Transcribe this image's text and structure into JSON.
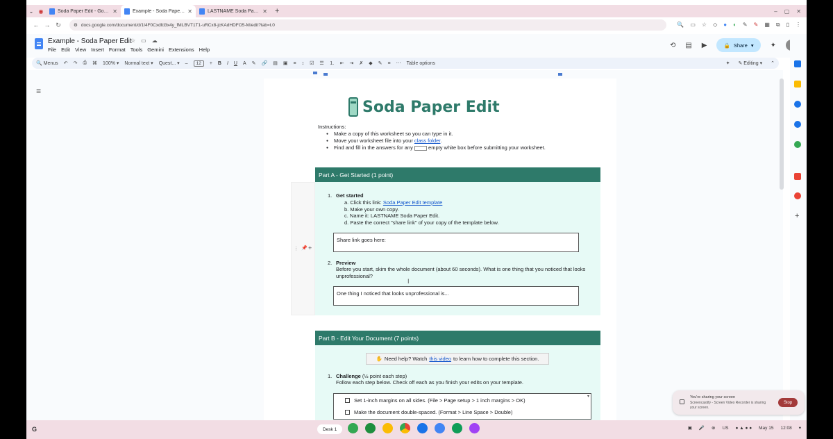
{
  "browser": {
    "tabs": [
      {
        "label": "Soda Paper Edit - Google Docs"
      },
      {
        "label": "Example - Soda Paper Edit - Go"
      },
      {
        "label": "LASTNAME Soda Paper Edit - G"
      }
    ],
    "url": "docs.google.com/document/d/1I4F0Cxdfd3x4y_fMLBVT1T1-uRCx8-jcKAdHDFO5-M/edit?tab=t.0"
  },
  "docs": {
    "title": "Example - Soda Paper Edit",
    "menu": [
      "File",
      "Edit",
      "View",
      "Insert",
      "Format",
      "Tools",
      "Gemini",
      "Extensions",
      "Help"
    ],
    "share_label": "Share",
    "toolbar": {
      "menus": "Menus",
      "zoom": "100%",
      "style": "Normal text",
      "font": "Quest...",
      "size": "12",
      "table_options": "Table options",
      "mode": "Editing"
    }
  },
  "content": {
    "title": "Soda Paper Edit",
    "instructions_label": "Instructions:",
    "instructions": [
      {
        "text": "Make a copy of this worksheet so you can type in it."
      },
      {
        "pre": "Move your worksheet file into your ",
        "link": "class folder",
        "post": "."
      },
      {
        "pre": "Find and fill in the answers for any ",
        "post": " empty white box before submitting your worksheet."
      }
    ],
    "part_a": {
      "header": "Part A -  Get Started (1 point)",
      "step1_title": "Get started",
      "step1_items": {
        "a_pre": "a.   Click this link: ",
        "a_link": "Soda Paper Edit template",
        "b": "b.   Make your own copy.",
        "c": "c.   Name it: LASTNAME Soda Paper Edit.",
        "d": "d.   Paste the correct \"share link\" of your copy of the template below."
      },
      "box1": "Share link goes here:",
      "step2_title": "Preview",
      "step2_text": "Before you start, skim the whole document (about 60 seconds). What is one thing that you noticed that looks unprofessional?",
      "box2": "One thing I noticed that looks unprofessional is..."
    },
    "part_b": {
      "header": "Part B -  Edit Your Document (7 points)",
      "help_pre": "Need help? Watch ",
      "help_link": "this video",
      "help_post": " to learn how to complete this section.",
      "challenge_title": "Challenge",
      "challenge_suffix": " (½ point each step)",
      "challenge_text": "Follow each step below. Check off each as you finish your edits on your template.",
      "checks": [
        "Set 1-inch margins on all sides. (File > Page setup > 1 inch margins > OK)",
        "Make the document double-spaced. (Format > Line Space > Double)"
      ]
    }
  },
  "notification": {
    "title": "You're sharing your screen",
    "body": "Screencastify - Screen Video Recorder is sharing your screen.",
    "stop": "Stop"
  },
  "shelf": {
    "desk": "Desk 1",
    "region": "US",
    "date": "May 15",
    "time": "12:08"
  },
  "colors": {
    "accent": "#2e7a6a",
    "section_bg": "#e7faf6"
  }
}
